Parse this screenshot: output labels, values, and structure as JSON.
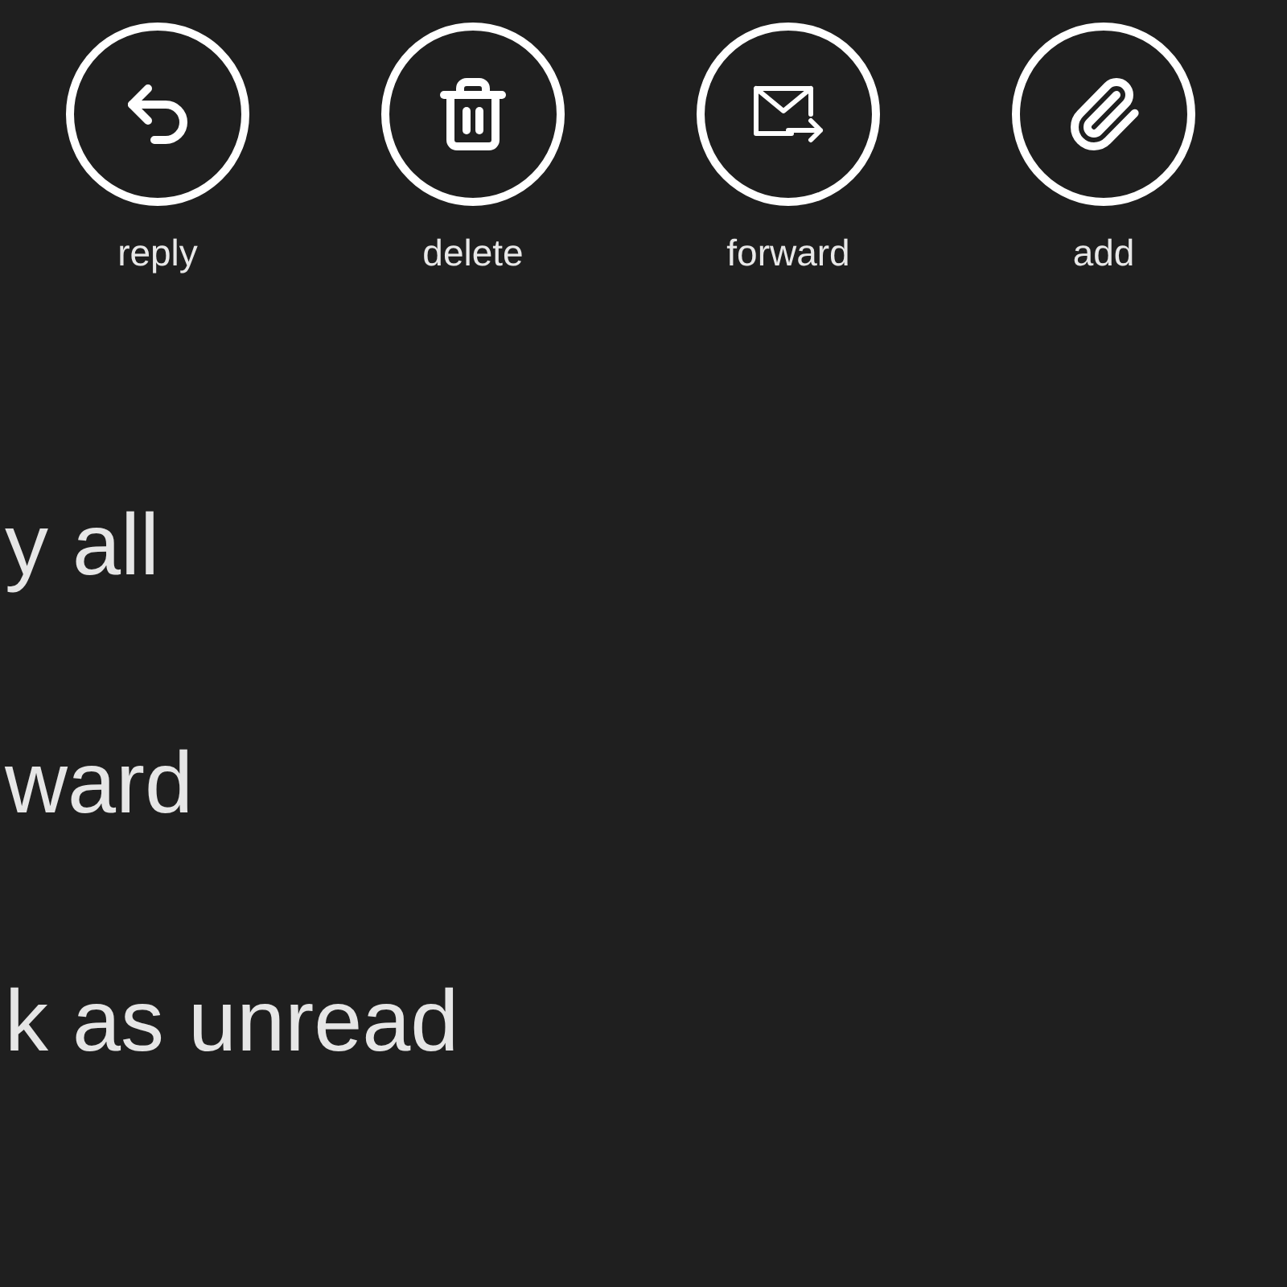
{
  "app_bar": [
    {
      "kind": "reply",
      "label": "reply"
    },
    {
      "kind": "delete",
      "label": "delete"
    },
    {
      "kind": "forward",
      "label": "forward"
    },
    {
      "kind": "attach",
      "label": "add"
    }
  ],
  "menu_items": [
    "y all",
    "ward",
    "k as unread"
  ]
}
